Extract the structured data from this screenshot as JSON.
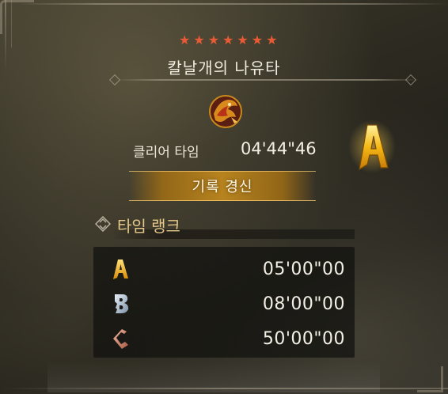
{
  "quest": {
    "star_count": 7,
    "stars": [
      "★",
      "★",
      "★",
      "★",
      "★",
      "★",
      "★"
    ],
    "star_color": "#e85a35",
    "monster_name": "칼날개의 나유타",
    "monster_icon": "monster-portrait-icon"
  },
  "result": {
    "clear_label": "클리어 타임",
    "clear_time": "04'44\"46",
    "rank_achieved": "A",
    "record_label": "기록 경신"
  },
  "time_rank": {
    "title": "타임 랭크",
    "rows": [
      {
        "rank": "A",
        "time": "05'00\"00",
        "color": "#f2b21a"
      },
      {
        "rank": "B",
        "time": "08'00\"00",
        "color": "#9fb4c8"
      },
      {
        "rank": "C",
        "time": "50'00\"00",
        "color": "#c8826a"
      }
    ]
  },
  "colors": {
    "gold_accent": "#e6c88a",
    "banner_gold": "#be871e"
  }
}
